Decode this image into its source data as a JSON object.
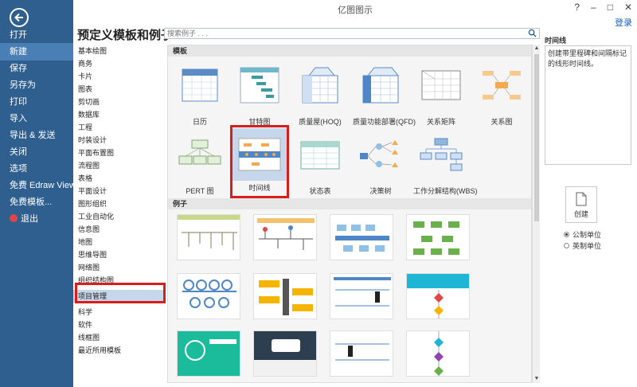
{
  "window": {
    "title": "亿图图示",
    "login": "登录"
  },
  "sidebar": {
    "items": [
      {
        "label": "打开"
      },
      {
        "label": "新建",
        "active": true
      },
      {
        "label": "保存"
      },
      {
        "label": "另存为"
      },
      {
        "label": "打印"
      },
      {
        "label": "导入"
      },
      {
        "label": "导出 & 发送"
      },
      {
        "label": "关闭"
      },
      {
        "label": "选项"
      },
      {
        "label": "免费 Edraw Viewer"
      },
      {
        "label": "免费模板..."
      },
      {
        "label": "退出"
      }
    ]
  },
  "main": {
    "heading": "预定义模板和例子",
    "search_placeholder": "搜索例子 . . .",
    "categories": [
      "基本绘图",
      "商务",
      "卡片",
      "图表",
      "剪切画",
      "数据库",
      "工程",
      "时装设计",
      "平面布置图",
      "流程图",
      "表格",
      "平面设计",
      "图形组织",
      "工业自动化",
      "信息图",
      "地图",
      "思维导图",
      "网络图",
      "组织结构图",
      "项目管理",
      "科学",
      "软件",
      "线框图",
      "最近所用模板"
    ],
    "selected_category": "项目管理",
    "templates_header": "模板",
    "templates": [
      "日历",
      "甘特图",
      "质量屋(HOQ)",
      "质量功能部署(QFD)",
      "关系矩阵",
      "关系图",
      "PERT 图",
      "时间线",
      "状态表",
      "决策树",
      "工作分解结构(WBS)"
    ],
    "selected_template": "时间线",
    "examples_header": "例子"
  },
  "right": {
    "title": "时间线",
    "description": "创建带里程碑和间隔标记的线形时间线。",
    "create_label": "创建",
    "units": [
      "公制单位",
      "英制单位"
    ],
    "selected_unit": "公制单位"
  },
  "colors": {
    "sidebar": "#2e5f8f",
    "accent": "#4a7fb5",
    "highlight": "#d81d1d",
    "selection": "#c6d7ec"
  }
}
